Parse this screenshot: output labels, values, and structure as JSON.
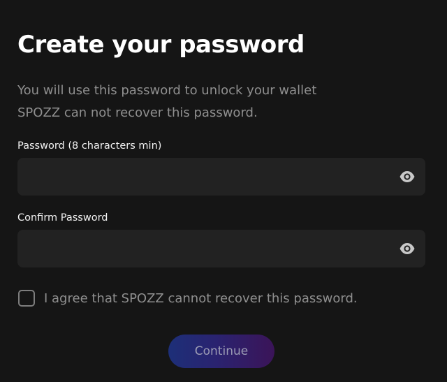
{
  "header": {
    "title": "Create your password",
    "subtitle_line1": "You will use this password to unlock your wallet",
    "subtitle_line2": "SPOZZ can not recover this password."
  },
  "form": {
    "password": {
      "label": "Password (8 characters min)",
      "value": "",
      "placeholder": "",
      "icon": "eye-icon"
    },
    "confirm_password": {
      "label": "Confirm Password",
      "value": "",
      "placeholder": "",
      "icon": "eye-icon"
    },
    "agreement": {
      "label": "I agree that SPOZZ cannot recover this password.",
      "checked": false
    },
    "continue_label": "Continue"
  },
  "colors": {
    "background": "#151515",
    "field_background": "#222222",
    "muted_text": "#8f8f8f",
    "button_gradient_start": "#1d2f78",
    "button_gradient_end": "#3b1458"
  }
}
